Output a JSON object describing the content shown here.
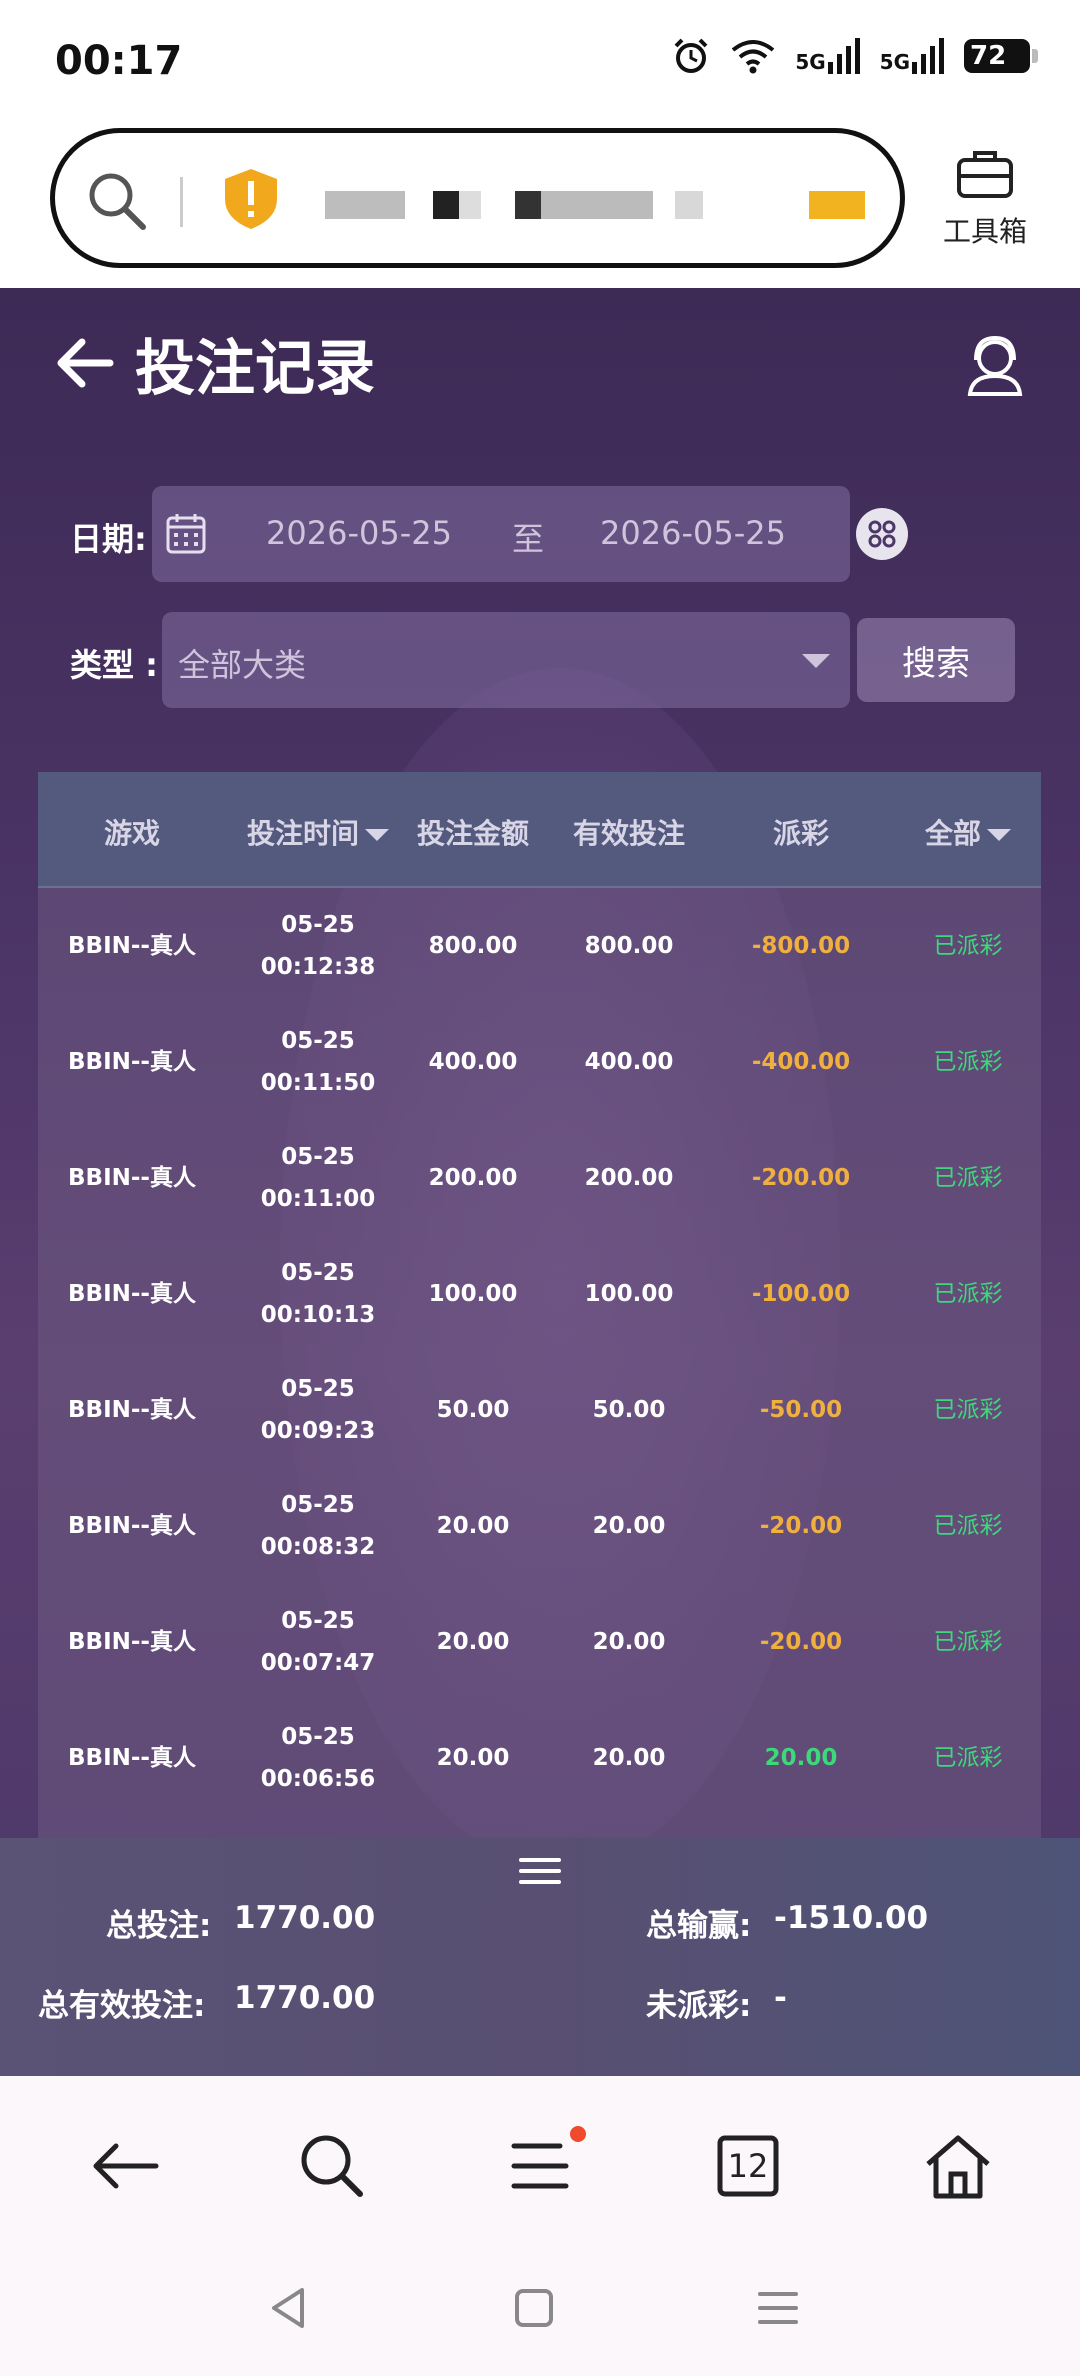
{
  "status_bar": {
    "time": "00:17",
    "network_1": "5G",
    "network_2": "5G",
    "battery": "72"
  },
  "browser": {
    "toolbox_label": "工具箱"
  },
  "page": {
    "title": "投注记录"
  },
  "filters": {
    "date_label": "日期:",
    "date_from": "2026-05-25",
    "date_sep": "至",
    "date_to": "2026-05-25",
    "type_label": "类型 :",
    "type_value": "全部大类",
    "search_label": "搜索"
  },
  "table": {
    "headers": [
      "游戏",
      "投注时间",
      "投注金额",
      "有效投注",
      "派彩",
      "全部"
    ],
    "rows": [
      {
        "game": "BBIN--真人",
        "date": "05-25",
        "time": "00:12:38",
        "amount": "800.00",
        "valid": "800.00",
        "payout": "-800.00",
        "status": "已派彩"
      },
      {
        "game": "BBIN--真人",
        "date": "05-25",
        "time": "00:11:50",
        "amount": "400.00",
        "valid": "400.00",
        "payout": "-400.00",
        "status": "已派彩"
      },
      {
        "game": "BBIN--真人",
        "date": "05-25",
        "time": "00:11:00",
        "amount": "200.00",
        "valid": "200.00",
        "payout": "-200.00",
        "status": "已派彩"
      },
      {
        "game": "BBIN--真人",
        "date": "05-25",
        "time": "00:10:13",
        "amount": "100.00",
        "valid": "100.00",
        "payout": "-100.00",
        "status": "已派彩"
      },
      {
        "game": "BBIN--真人",
        "date": "05-25",
        "time": "00:09:23",
        "amount": "50.00",
        "valid": "50.00",
        "payout": "-50.00",
        "status": "已派彩"
      },
      {
        "game": "BBIN--真人",
        "date": "05-25",
        "time": "00:08:32",
        "amount": "20.00",
        "valid": "20.00",
        "payout": "-20.00",
        "status": "已派彩"
      },
      {
        "game": "BBIN--真人",
        "date": "05-25",
        "time": "00:07:47",
        "amount": "20.00",
        "valid": "20.00",
        "payout": "-20.00",
        "status": "已派彩"
      },
      {
        "game": "BBIN--真人",
        "date": "05-25",
        "time": "00:06:56",
        "amount": "20.00",
        "valid": "20.00",
        "payout": "20.00",
        "status": "已派彩"
      }
    ]
  },
  "summary": {
    "total_bet_label": "总投注:",
    "total_bet": "1770.00",
    "total_winloss_label": "总输赢:",
    "total_winloss": "-1510.00",
    "total_valid_label": "总有效投注:",
    "total_valid": "1770.00",
    "unsettled_label": "未派彩:",
    "unsettled": "-"
  },
  "bottom_nav": {
    "tabs_count": "12"
  },
  "colors": {
    "negative": "#f0b040",
    "positive": "#3cd87a",
    "table_header": "#54597e"
  }
}
